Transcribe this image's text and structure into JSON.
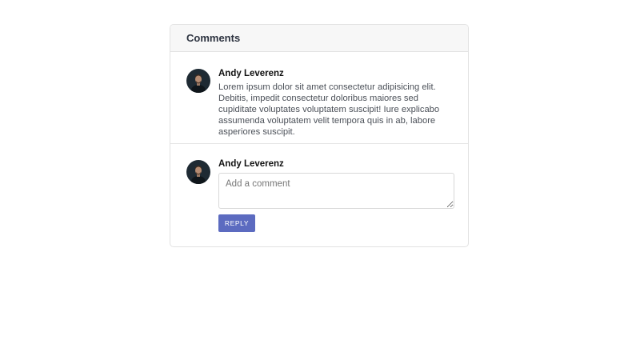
{
  "card": {
    "title": "Comments"
  },
  "comments": [
    {
      "author": "Andy Leverenz",
      "avatar_icon": "user-avatar",
      "body": "Lorem ipsum dolor sit amet consectetur adipisicing elit. Debitis, impedit consectetur doloribus maiores sed cupiditate voluptates voluptatem suscipit! Iure explicabo assumenda voluptatem velit tempora quis in ab, labore asperiores suscipit."
    }
  ],
  "reply_form": {
    "author": "Andy Leverenz",
    "avatar_icon": "user-avatar",
    "placeholder": "Add a comment",
    "value": "",
    "button_label": "REPLY",
    "button_color": "#5c6bc0"
  }
}
